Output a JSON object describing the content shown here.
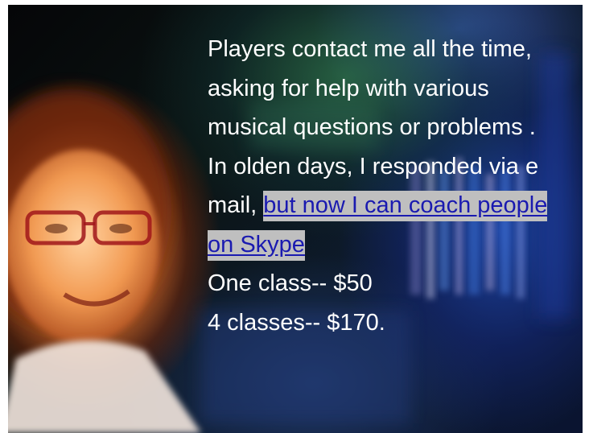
{
  "intro_text": "Players contact me all the time, asking for help with various musical questions or problems .  In olden days, I responded via e mail,",
  "coaching_link": {
    "label": "but now I can coach people on Skype"
  },
  "pricing": [
    {
      "label": "One class-- $50"
    },
    {
      "label": "4 classes-- $170."
    }
  ],
  "colors": {
    "text": "#ffffff",
    "link_text": "#1a1ab0",
    "link_highlight": "#bfbfbf",
    "page_background": "#ffffff"
  }
}
